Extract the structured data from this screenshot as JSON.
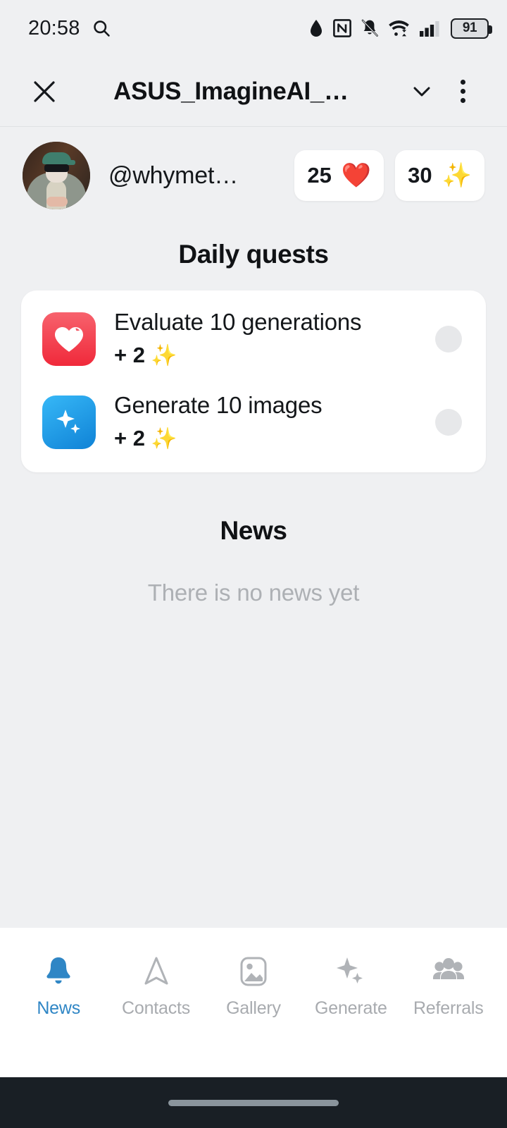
{
  "status_bar": {
    "time": "20:58",
    "search_icon": "search-icon",
    "icons": [
      "water-drop-icon",
      "nfc-icon",
      "bell-muted-icon",
      "wifi-icon",
      "cellular-signal-icon"
    ],
    "battery_level": "91"
  },
  "app_bar": {
    "close_label": "close-icon",
    "title": "ASUS_ImagineAI_…",
    "expand_label": "chevron-down-icon",
    "overflow_label": "more-options-icon"
  },
  "profile": {
    "avatar_alt": "user-avatar",
    "username": "@whymet…",
    "chips": [
      {
        "value": "25",
        "icon": "❤️",
        "icon_name": "heart-icon"
      },
      {
        "value": "30",
        "icon": "✨",
        "icon_name": "sparkles-icon"
      }
    ]
  },
  "daily_quests": {
    "title": "Daily quests",
    "items": [
      {
        "icon_name": "heart-icon",
        "icon_color": "#f0293a",
        "title": "Evaluate 10 generations",
        "reward": "+ 2",
        "reward_icon": "✨",
        "status": "incomplete"
      },
      {
        "icon_name": "sparkles-icon",
        "icon_color": "#0f82d6",
        "title": "Generate 10 images",
        "reward": "+ 2",
        "reward_icon": "✨",
        "status": "incomplete"
      }
    ]
  },
  "news": {
    "title": "News",
    "empty_text": "There is no news yet"
  },
  "bottom_nav": {
    "active_color": "#2f86c5",
    "inactive_color": "#a8abaf",
    "items": [
      {
        "label": "News",
        "icon": "bell-icon",
        "active": true
      },
      {
        "label": "Contacts",
        "icon": "navigation-arrow-icon",
        "active": false
      },
      {
        "label": "Gallery",
        "icon": "image-icon",
        "active": false
      },
      {
        "label": "Generate",
        "icon": "sparkles-icon",
        "active": false
      },
      {
        "label": "Referrals",
        "icon": "people-group-icon",
        "active": false
      }
    ]
  }
}
